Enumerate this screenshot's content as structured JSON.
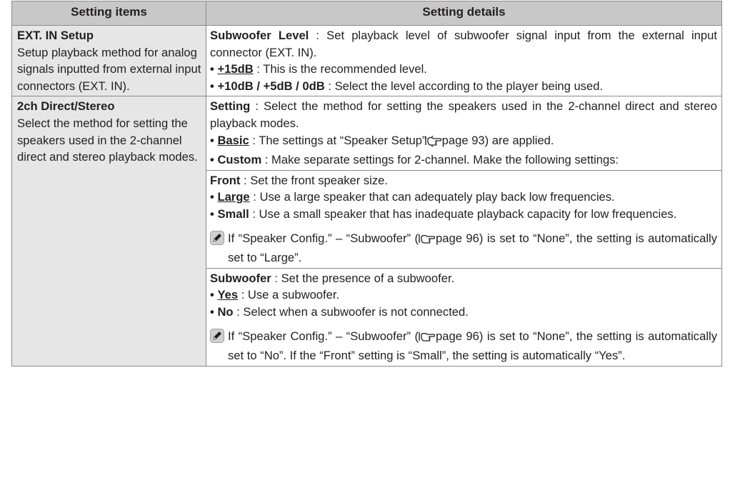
{
  "header": {
    "col1": "Setting items",
    "col2": "Setting details"
  },
  "ext_in": {
    "title": "EXT. IN Setup",
    "desc": "Setup playback method for analog signals inputted from external input connectors (EXT. IN).",
    "sub_label": "Subwoofer Level",
    "sub_text": " : Set playback level of subwoofer signal input from the external input connector (EXT. IN).",
    "opt1_label": "+15dB",
    "opt1_text": " : This is the recommended level.",
    "opt2_label": "+10dB / +5dB / 0dB",
    "opt2_text": " : Select the level according to the player being used."
  },
  "direct": {
    "title": "2ch Direct/Stereo",
    "desc": "Select the method for setting the speakers used in the 2-channel direct and stereo playback modes.",
    "setting_label": "Setting",
    "setting_text": " : Select the method for setting the speakers used in the 2-channel direct and stereo playback modes.",
    "basic_label": "Basic",
    "basic_text_a": " : The settings at “Speaker Setup” (",
    "basic_text_b": "page 93) are applied.",
    "custom_label": "Custom",
    "custom_text": " : Make separate settings for 2-channel. Make the following settings:",
    "front_label": "Front",
    "front_text": " : Set the front speaker size.",
    "large_label": "Large",
    "large_text": " : Use a large speaker that can adequately play back low frequencies.",
    "small_label": "Small",
    "small_text": " : Use a small speaker that has inadequate playback capacity for low frequencies.",
    "note1_a": "If “Speaker Config.” – “Subwoofer” (",
    "note1_b": "page 96) is set to “None”, the setting is automatically set to “Large”.",
    "subwoofer_label": "Subwoofer",
    "subwoofer_text": " : Set the presence of a subwoofer.",
    "yes_label": "Yes",
    "yes_text": " : Use a subwoofer.",
    "no_label": "No",
    "no_text": " : Select when a subwoofer is not connected.",
    "note2_a": "If “Speaker Config.” – “Subwoofer” (",
    "note2_b": "page 96) is set to “None”, the setting is automatically set to “No”. If the “Front” setting is “Small”, the setting is automatically “Yes”."
  },
  "icons": {
    "bullet": "•",
    "note": "pencil-note-icon",
    "page_ref": "hand-pointer-icon"
  }
}
